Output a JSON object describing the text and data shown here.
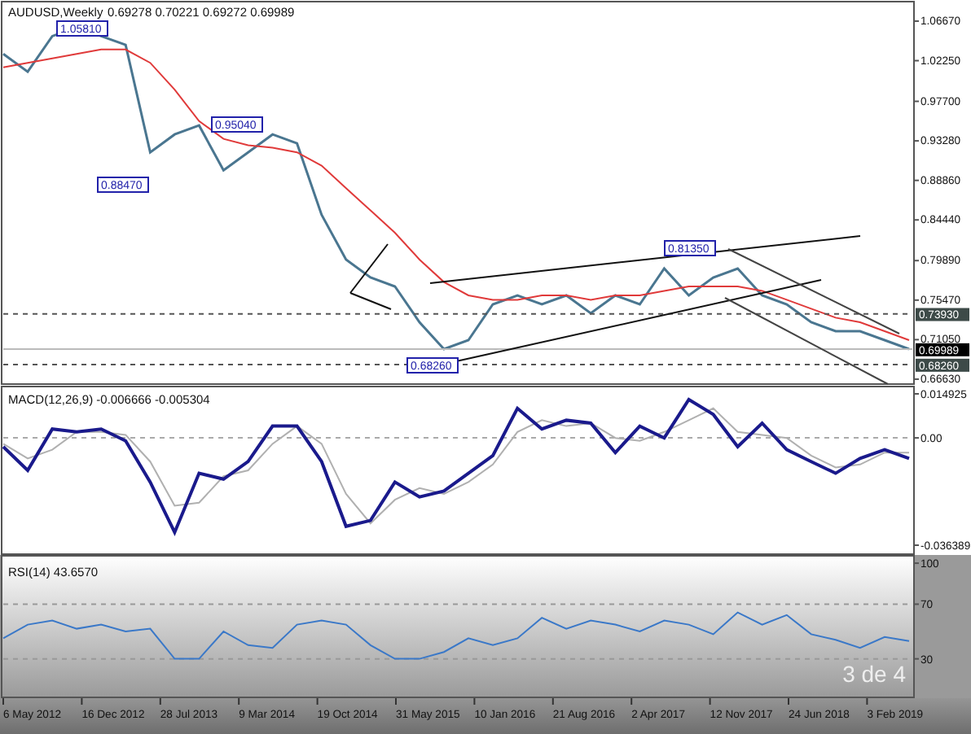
{
  "main_chart": {
    "header": "AUDUSD,Weekly",
    "ohlc": [
      "0.69278",
      "0.70221",
      "0.69272",
      "0.69989"
    ],
    "chart_data": {
      "type": "line",
      "ylim": [
        0.6608,
        1.0885
      ],
      "yticks": [
        {
          "value": 1.0667,
          "label": "1.06670"
        },
        {
          "value": 1.0225,
          "label": "1.02250"
        },
        {
          "value": 0.977,
          "label": "0.97700"
        },
        {
          "value": 0.9328,
          "label": "0.93280"
        },
        {
          "value": 0.8886,
          "label": "0.88860"
        },
        {
          "value": 0.8444,
          "label": "0.84440"
        },
        {
          "value": 0.7989,
          "label": "0.79890"
        },
        {
          "value": 0.7547,
          "label": "0.75470"
        },
        {
          "value": 0.7105,
          "label": "0.71050"
        },
        {
          "value": 0.6663,
          "label": "0.66630"
        }
      ],
      "series": [
        {
          "color": "#4a7690",
          "values": [
            1.03,
            1.01,
            1.05,
            1.06,
            1.05,
            1.04,
            0.92,
            0.94,
            0.95,
            0.9,
            0.92,
            0.94,
            0.93,
            0.85,
            0.8,
            0.78,
            0.77,
            0.73,
            0.7,
            0.71,
            0.75,
            0.76,
            0.75,
            0.76,
            0.74,
            0.76,
            0.75,
            0.79,
            0.76,
            0.78,
            0.79,
            0.76,
            0.75,
            0.73,
            0.72,
            0.72,
            0.71,
            0.7
          ]
        },
        {
          "color": "#e03a3a",
          "values": [
            1.015,
            1.02,
            1.025,
            1.03,
            1.035,
            1.035,
            1.02,
            0.99,
            0.955,
            0.935,
            0.928,
            0.925,
            0.92,
            0.905,
            0.88,
            0.855,
            0.83,
            0.8,
            0.775,
            0.76,
            0.755,
            0.755,
            0.76,
            0.76,
            0.755,
            0.76,
            0.76,
            0.765,
            0.77,
            0.77,
            0.77,
            0.765,
            0.755,
            0.745,
            0.735,
            0.73,
            0.72,
            0.71
          ]
        }
      ],
      "annotations": [
        "1.05810",
        "0.95040",
        "0.88470",
        "0.68260",
        "0.81350"
      ]
    },
    "price_tags": [
      {
        "label": "0.73930",
        "color": "#3d4a48"
      },
      {
        "label": "0.69989",
        "color": "#000000"
      },
      {
        "label": "0.68260",
        "color": "#3d4a48"
      }
    ]
  },
  "macd": {
    "header": "MACD(12,26,9) -0.006666 -0.005304",
    "chart_data": {
      "type": "line",
      "ylim": [
        -0.03942,
        0.01741
      ],
      "yticks": [
        {
          "value": 0.014925,
          "label": "0.014925"
        },
        {
          "value": 0,
          "label": "0.00"
        },
        {
          "value": -0.036389,
          "label": "-0.036389"
        }
      ],
      "series": [
        {
          "color": "#1a1a8c",
          "values": [
            -0.003,
            -0.011,
            0.003,
            0.002,
            0.003,
            -0.001,
            -0.015,
            -0.032,
            -0.012,
            -0.014,
            -0.008,
            0.004,
            0.004,
            -0.008,
            -0.03,
            -0.028,
            -0.015,
            -0.02,
            -0.018,
            -0.012,
            -0.006,
            0.01,
            0.003,
            0.006,
            0.005,
            -0.005,
            0.004,
            0.0,
            0.013,
            0.008,
            -0.003,
            0.005,
            -0.004,
            -0.008,
            -0.012,
            -0.007,
            -0.004,
            -0.007
          ]
        },
        {
          "color": "#b0b0b0",
          "values": [
            -0.002,
            -0.007,
            -0.004,
            0.002,
            0.002,
            0.001,
            -0.008,
            -0.023,
            -0.022,
            -0.013,
            -0.011,
            -0.002,
            0.004,
            -0.002,
            -0.019,
            -0.029,
            -0.021,
            -0.017,
            -0.019,
            -0.015,
            -0.009,
            0.002,
            0.006,
            0.004,
            0.005,
            0.0,
            -0.001,
            0.002,
            0.006,
            0.01,
            0.002,
            0.001,
            0.0,
            -0.006,
            -0.01,
            -0.009,
            -0.005,
            -0.005
          ]
        }
      ]
    }
  },
  "rsi": {
    "header": "RSI(14) 43.6570",
    "chart_data": {
      "type": "line",
      "ylim": [
        1.8,
        105.4
      ],
      "yticks": [
        {
          "value": 100,
          "label": "100"
        },
        {
          "value": 70,
          "label": "70"
        },
        {
          "value": 30,
          "label": "30"
        }
      ],
      "series": [
        {
          "color": "#3a78c8",
          "values": [
            45,
            55,
            58,
            52,
            55,
            50,
            52,
            30,
            30,
            50,
            40,
            38,
            55,
            58,
            55,
            40,
            30,
            30,
            35,
            45,
            40,
            45,
            60,
            52,
            58,
            55,
            50,
            58,
            55,
            48,
            64,
            55,
            62,
            48,
            44,
            38,
            46,
            43
          ]
        }
      ]
    }
  },
  "date_axis": [
    "6 May 2012",
    "16 Dec 2012",
    "28 Jul 2013",
    "9 Mar 2014",
    "19 Oct 2014",
    "31 May 2015",
    "10 Jan 2016",
    "21 Aug 2016",
    "2 Apr 2017",
    "12 Nov 2017",
    "24 Jun 2018",
    "3 Feb 2019"
  ],
  "slide_counter": "3 de 4"
}
